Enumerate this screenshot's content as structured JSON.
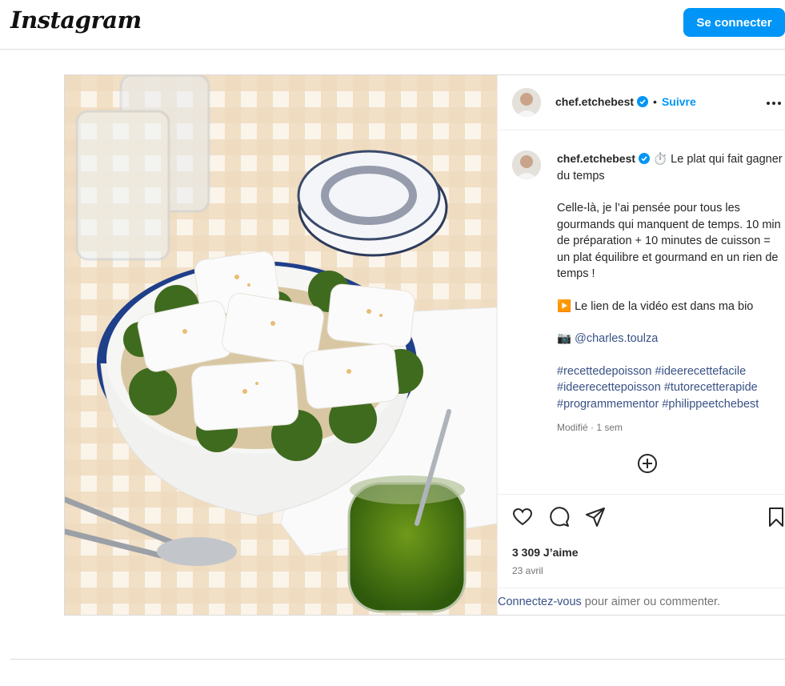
{
  "topbar": {
    "logo": "Instagram",
    "login_button": "Se connecter"
  },
  "post": {
    "author": "chef.etchebest",
    "follow": "Suivre",
    "dot": "•",
    "caption": {
      "line1_after_user": "⏱️ Le plat qui fait gagner du temps",
      "para2": "Celle-là, je l’ai pensée pour tous les gourmands qui manquent de temps. 10 min de préparation + 10 minutes de cuisson = un plat équilibre et gourmand en un rien de temps !",
      "para3": "▶️ Le lien de la vidéo est dans ma bio",
      "para4_icon": "📷",
      "mention": "@charles.toulza",
      "hashtags": [
        "#recettedepoisson",
        "#ideerecettefacile",
        "#ideerecettepoisson",
        "#tutorecetterapide",
        "#programmementor",
        "#philippeetchebest"
      ],
      "meta": "Modifié · 1 sem"
    },
    "likes": "3 309 J’aime",
    "date": "23 avril",
    "login_prompt": {
      "link": "Connectez-vous",
      "rest": " pour aimer ou commenter."
    }
  },
  "icons": {
    "more": "more-options-icon",
    "add_comment": "plus-circle-icon",
    "like": "heart-icon",
    "comment": "comment-icon",
    "share": "send-icon",
    "save": "bookmark-icon",
    "verified": "verified-badge-icon"
  },
  "colors": {
    "accent": "#0095f6",
    "link": "#385185",
    "muted": "#737373",
    "border": "#dbdbdb"
  }
}
